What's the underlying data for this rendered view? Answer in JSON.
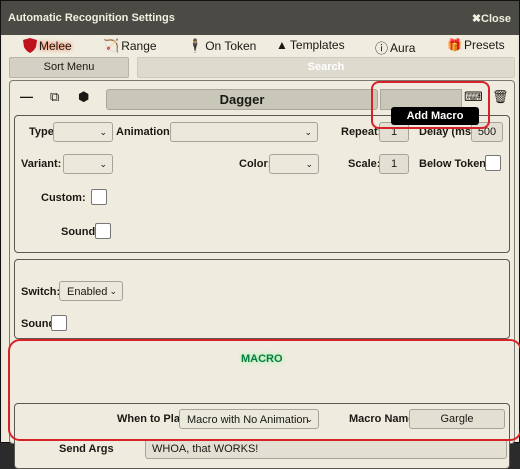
{
  "window": {
    "title": "Automatic Recognition Settings",
    "close_label": "Close"
  },
  "tabs": [
    {
      "label": "Melee",
      "icon": "shield-icon"
    },
    {
      "label": "Range",
      "icon": "archer-icon"
    },
    {
      "label": "On Token",
      "icon": "person-icon"
    },
    {
      "label": "Templates",
      "icon": "shapes-icon"
    },
    {
      "label": "Aura",
      "icon": "circle-info-icon"
    },
    {
      "label": "Presets",
      "icon": "gift-icon"
    }
  ],
  "toolbar": {
    "sort_menu_label": "Sort Menu",
    "search_placeholder": "Search"
  },
  "entry": {
    "name": "Dagger",
    "tooltip": "Add Macro"
  },
  "settings": {
    "type_label": "Type",
    "animation_label": "Animation:",
    "repeat_label": "Repeat:",
    "repeat_value": "1",
    "delay_label": "Delay (ms):",
    "delay_value": "500",
    "variant_label": "Variant:",
    "color_label": "Color:",
    "scale_label": "Scale:",
    "scale_value": "1",
    "below_token_label": "Below Token:",
    "custom_label": "Custom:",
    "sound_label": "Sound"
  },
  "switch_section": {
    "switch_label": "Switch:",
    "switch_value": "Enabled",
    "sound_label": "Sound"
  },
  "macro": {
    "header": "MACRO",
    "when_to_play_label": "When to Play",
    "when_to_play_value": "Macro with No Animation",
    "macro_name_label": "Macro Name",
    "macro_name_value": "Gargle",
    "send_args_label": "Send Args",
    "send_args_value": "WHOA, that WORKS!"
  },
  "colors": {
    "highlight_border": "#d8222a",
    "macro_header": "#0a7a4a"
  }
}
